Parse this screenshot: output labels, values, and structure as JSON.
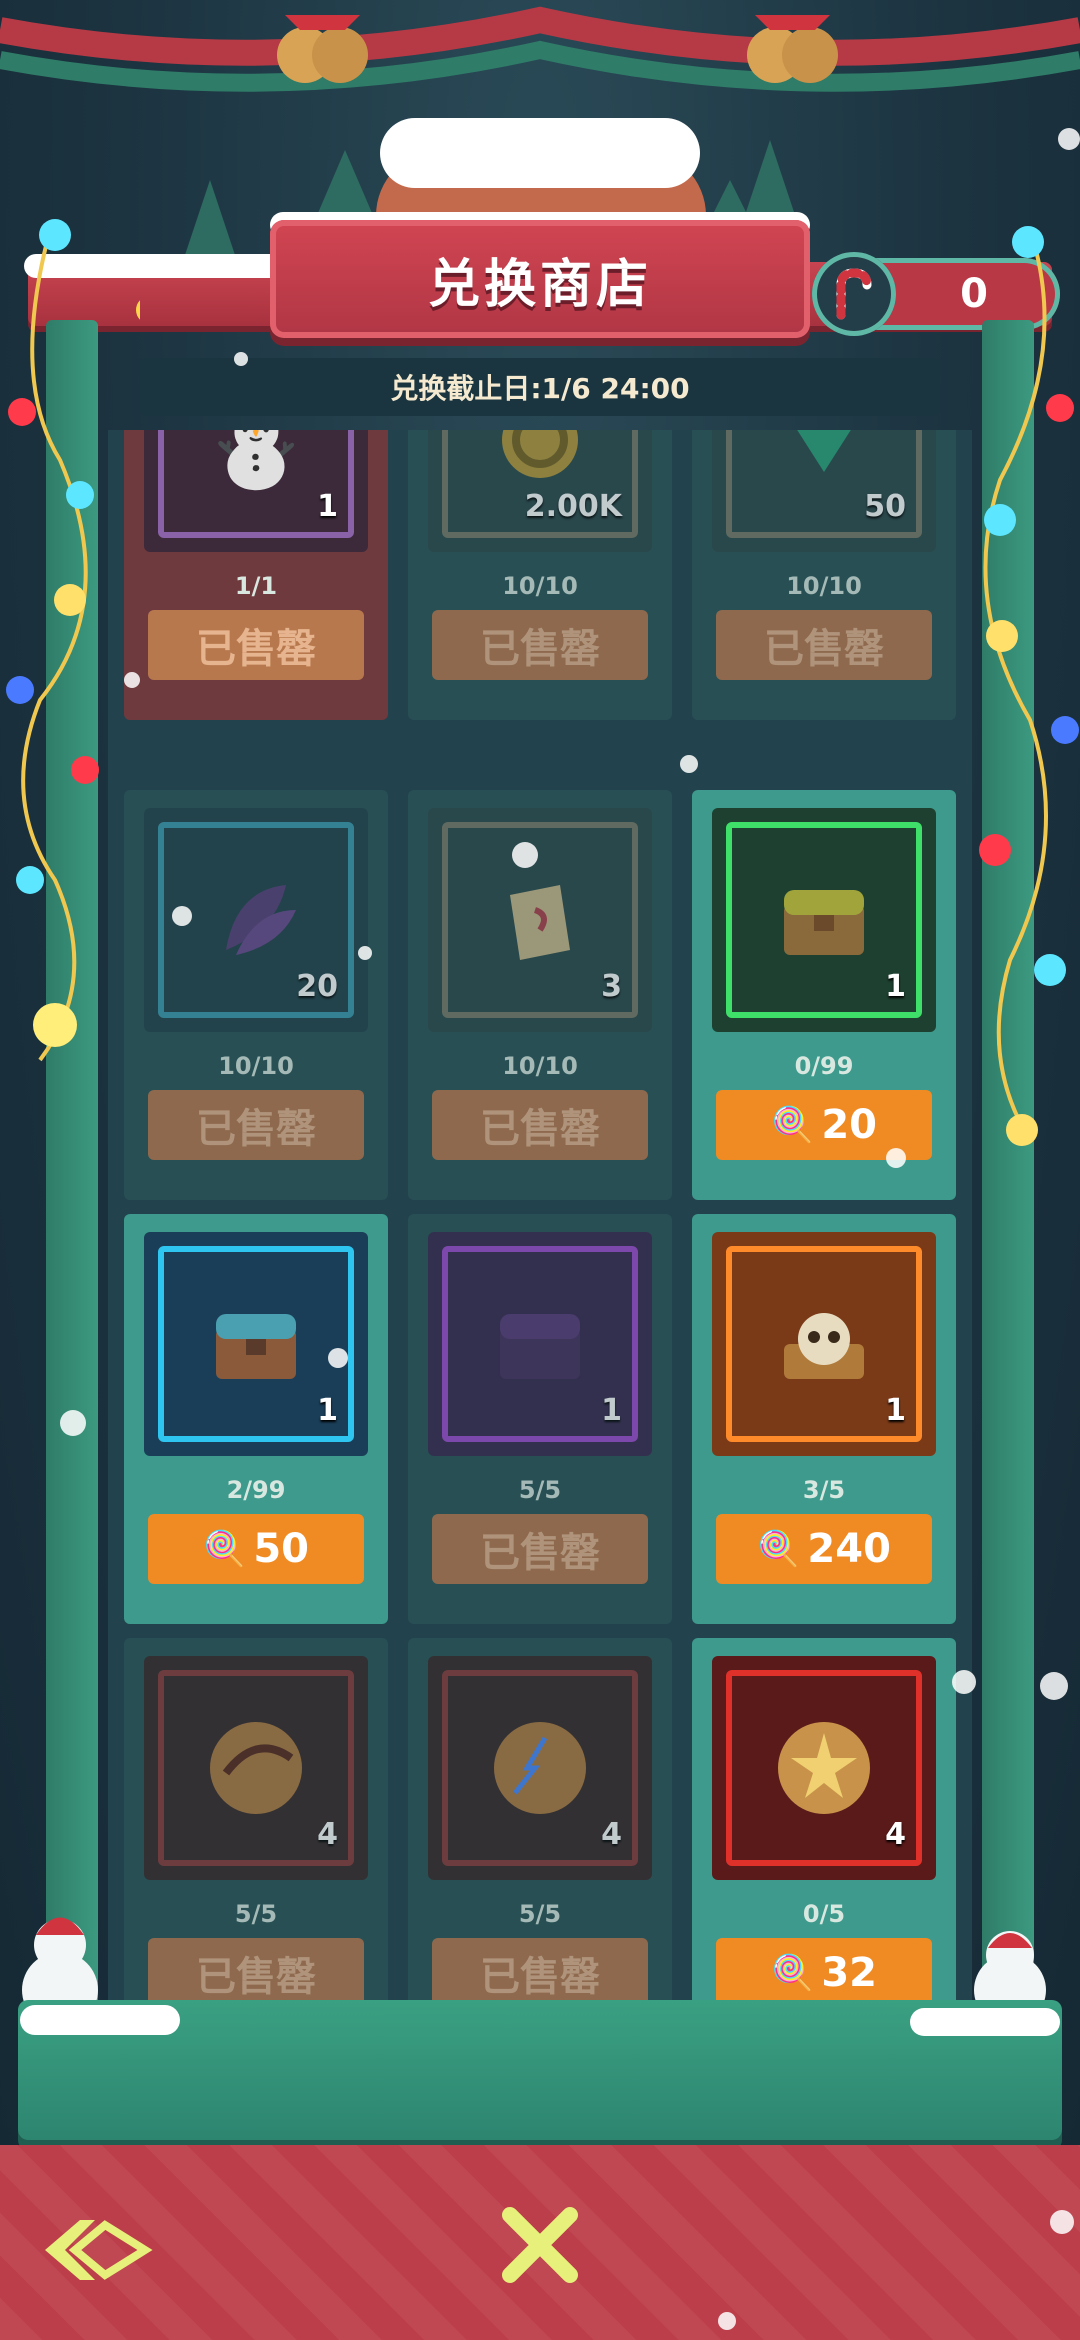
{
  "header": {
    "title": "兑换商店",
    "currency_amount": "0",
    "deadline": "兑换截止日:1/6 24:00"
  },
  "items": [
    {
      "name": "snowman-creature",
      "qty": "1",
      "limit": "1/1",
      "button": "已售罄",
      "state": "sold"
    },
    {
      "name": "gold-coin",
      "qty": "2.00K",
      "limit": "10/10",
      "button": "已售罄",
      "state": "sold"
    },
    {
      "name": "emerald-gem",
      "qty": "50",
      "limit": "10/10",
      "button": "已售罄",
      "state": "sold"
    },
    {
      "name": "purple-feather",
      "qty": "20",
      "limit": "10/10",
      "button": "已售罄",
      "state": "sold"
    },
    {
      "name": "scroll",
      "qty": "3",
      "limit": "10/10",
      "button": "已售罄",
      "state": "sold"
    },
    {
      "name": "green-chest",
      "qty": "1",
      "limit": "0/99",
      "button": "20",
      "state": "buy"
    },
    {
      "name": "blue-chest",
      "qty": "1",
      "limit": "2/99",
      "button": "50",
      "state": "buy"
    },
    {
      "name": "purple-chest",
      "qty": "1",
      "limit": "5/5",
      "button": "已售罄",
      "state": "sold"
    },
    {
      "name": "skull-chest",
      "qty": "1",
      "limit": "3/5",
      "button": "240",
      "state": "buy"
    },
    {
      "name": "flame-orb",
      "qty": "4",
      "limit": "5/5",
      "button": "已售罄",
      "state": "sold"
    },
    {
      "name": "lightning-orb",
      "qty": "4",
      "limit": "5/5",
      "button": "已售罄",
      "state": "sold"
    },
    {
      "name": "star-orb",
      "qty": "4",
      "limit": "0/5",
      "button": "32",
      "state": "buy"
    }
  ],
  "colors": {
    "buy_button": "#f08a22",
    "sold_button": "#b8784e",
    "accent_red": "#bc3e4a",
    "accent_teal": "#3d9a8c"
  }
}
